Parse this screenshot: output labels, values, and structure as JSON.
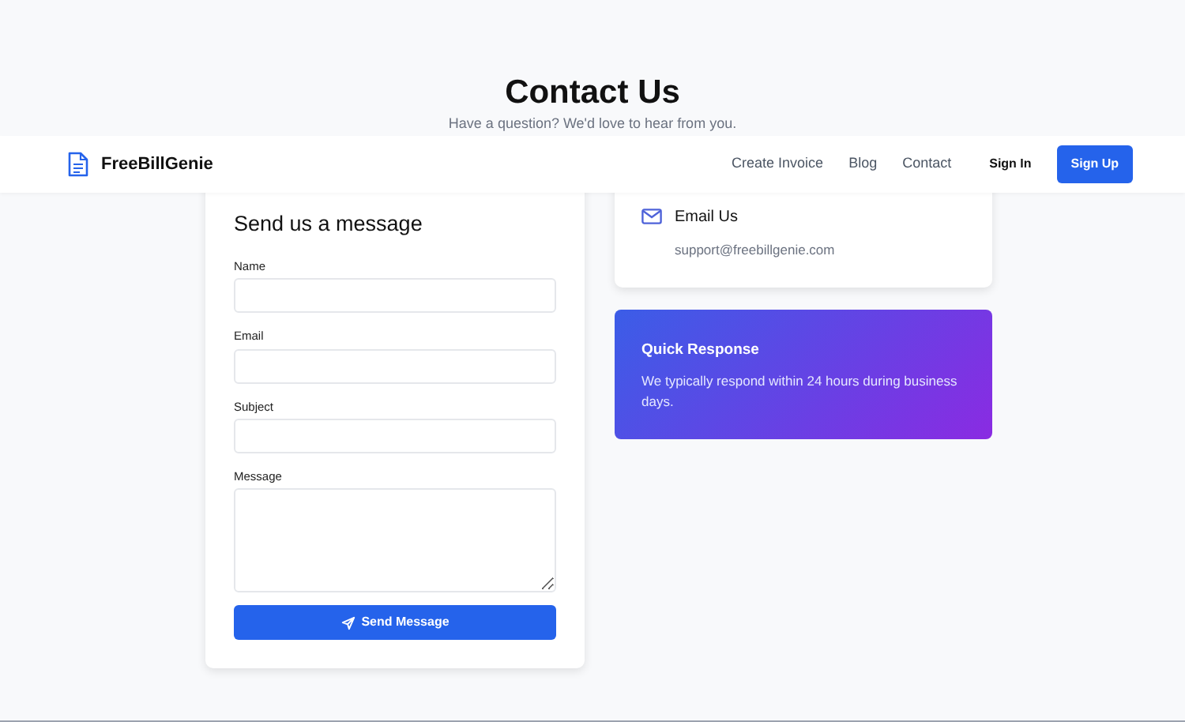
{
  "page": {
    "title": "Contact Us",
    "subtitle": "Have a question? We'd love to hear from you."
  },
  "navbar": {
    "brand": "FreeBillGenie",
    "links": [
      {
        "label": "Create Invoice"
      },
      {
        "label": "Blog"
      },
      {
        "label": "Contact"
      }
    ],
    "sign_in": "Sign In",
    "sign_up": "Sign Up"
  },
  "form": {
    "title": "Send us a message",
    "fields": [
      {
        "label": "Name",
        "kind": "input"
      },
      {
        "label": "Email",
        "kind": "input"
      },
      {
        "label": "Subject",
        "kind": "input"
      },
      {
        "label": "Message",
        "kind": "textarea"
      }
    ],
    "submit": "Send Message"
  },
  "email_card": {
    "title": "Email Us",
    "address": "support@freebillgenie.com"
  },
  "response_card": {
    "title": "Quick Response",
    "text": "We typically respond within 24 hours during business days."
  }
}
